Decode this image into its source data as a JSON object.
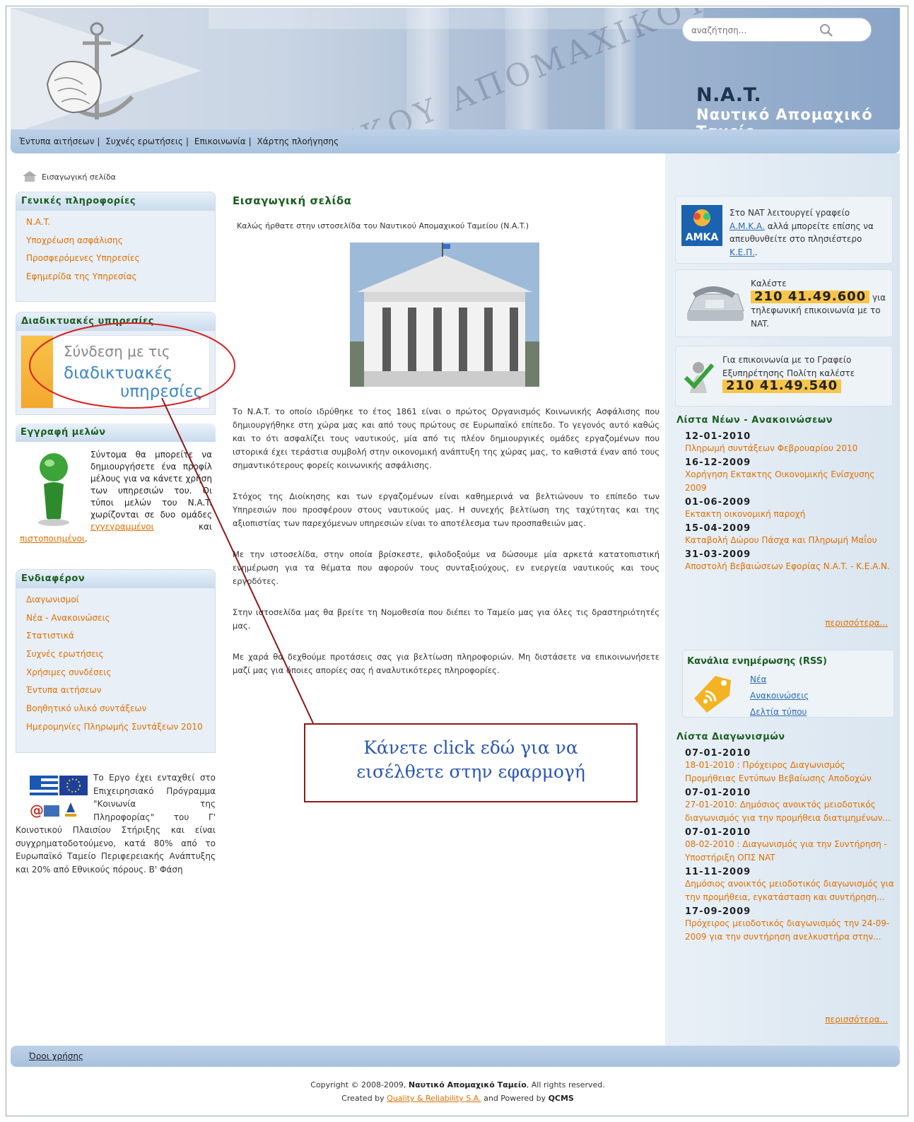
{
  "search": {
    "placeholder": "αναζήτηση..."
  },
  "header": {
    "abbr": "N.A.T.",
    "full": "Ναυτικό Απομαχικό Ταμείο",
    "facade_text": "ΝΑΥΤΙΚΟΥ ΑΠΟΜΑΧΙΚΟΥ ΤΑΜΕΙΟΥ"
  },
  "topnav": [
    "Έντυπα αιτήσεων",
    "Συχνές ερωτήσεις",
    "Επικοινωνία",
    "Χάρτης πλοήγησης"
  ],
  "breadcrumb": "Εισαγωγική σελίδα",
  "left": {
    "general": {
      "title": "Γενικές πληροφορίες",
      "items": [
        "N.A.T.",
        "Υποχρέωση ασφάλισης",
        "Προσφερόμενες Υπηρεσίες",
        "Εφημερίδα της Υπηρεσίας"
      ]
    },
    "online": {
      "title": "Διαδικτυακές υπηρεσίες",
      "banner": [
        "Σύνδεση με τις",
        "διαδικτυακές",
        "υπηρεσίες"
      ]
    },
    "members": {
      "title": "Εγγραφή μελών",
      "text": "Σύντομα θα μπορείτε να δημιουργήσετε ένα προφίλ μέλους για να κάνετε χρήση των υπηρεσιών του. Οι τύποι μελών του N.A.T. χωρίζονται σε δυο ομάδες",
      "link1": "εγγεγραμμένοι",
      "and": "και",
      "link2": "πιστοποιημένοι",
      "end": "."
    },
    "interest": {
      "title": "Ενδιαφέρον",
      "items": [
        "Διαγωνισμοί",
        "Νέα - Ανακοινώσεις",
        "Στατιστικά",
        "Συχνές ερωτήσεις",
        "Χρήσιμες συνδέσεις",
        "Έντυπα αιτήσεων",
        "Βοηθητικό υλικό συντάξεων",
        "Ημερομηνίες Πληρωμής Συντάξεων 2010"
      ]
    },
    "eu": "Το Εργο έχει ενταχθεί στο Επιχειρησιακό Πρόγραμμα \"Κοινωνία της Πληροφορίας\" του Γ' Κοινοτικού Πλαισίου Στήριξης και είναι συγχρηματοδοτούμενο, κατά 80% από το Ευρωπαϊκό Ταμείο Περιφερειακής Ανάπτυξης και 20% από Εθνικούς πόρους. Β' Φάση"
  },
  "main": {
    "title": "Εισαγωγική σελίδα",
    "welcome": "Καλώς ήρθατε στην ιστοσελίδα του Ναυτικού Απομαχικού Ταμείου (N.A.T.)",
    "paragraphs": [
      "Το N.A.T. το οποίο ιδρύθηκε το έτος 1861 είναι ο πρώτος Οργανισμός Κοινωνικής Ασφάλισης που δημιουργήθηκε στη χώρα μας και από τους πρώτους σε Ευρωπαϊκό επίπεδο. Το γεγονός αυτό καθώς και το ότι ασφαλίζει τους ναυτικούς, μία από τις πλέον δημιουργικές ομάδες εργαζομένων που ιστορικά έχει τεράστια συμβολή στην οικονομική ανάπτυξη της χώρας μας, το καθιστά έναν από τους σημαντικότερους φορείς κοινωνικής ασφάλισης.",
      "Στόχος της Διοίκησης και των εργαζομένων είναι καθημερινά να βελτιώνουν το επίπεδο των Υπηρεσιών που προσφέρουν στους ναυτικούς μας. Η συνεχής βελτίωση της ταχύτητας και της αξιοπιστίας των παρεχόμενων υπηρεσιών είναι το αποτέλεσμα των προσπαθειών μας.",
      "Με την ιστοσελίδα, στην οποία βρίσκεστε, φιλοδοξούμε να δώσουμε μία αρκετά κατατοπιστική ενημέρωση για τα θέματα που αφορούν τους συνταξιούχους, εν ενεργεία ναυτικούς και τους εργοδότες.",
      "Στην ιστοσελίδα μας θα βρείτε τη Νομοθεσία που διέπει το Ταμείο μας για όλες τις δραστηριότητές μας.",
      "Με χαρά θα δεχθούμε προτάσεις σας για βελτίωση πληροφοριών. Μη διστάσετε να επικοινωνήσετε μαζί μας για όποιες απορίες σας ή αναλυτικότερες πληροφορίες."
    ]
  },
  "callout": [
    "Κάνετε click εδώ για να",
    "εισέλθετε στην εφαρμογή"
  ],
  "right": {
    "amka": {
      "pre": "Στο NAT λειτουργεί γραφείο",
      "link1": "Α.Μ.Κ.Α.",
      "mid": "αλλά μπορείτε επίσης να απευθυνθείτε στο πλησιέστερο",
      "link2": "Κ.Ε.Π.",
      "end": ".",
      "logo": "AMKA"
    },
    "call": {
      "pre": "Καλέστε",
      "phone": "210 41.49.600",
      "post": "για τηλεφωνική επικοινωνία με το NAT."
    },
    "citizen": {
      "pre": "Για επικοινωνία με το Γραφείο Εξυπηρέτησης Πολίτη καλέστε",
      "phone": "210 41.49.540"
    },
    "news_title": "Λίστα Νέων - Ανακοινώσεων",
    "news": [
      {
        "date": "12-01-2010",
        "text": "Πληρωμή συντάξεων Φεβρουαρίου 2010"
      },
      {
        "date": "16-12-2009",
        "text": "Χορήγηση Εκτακτης Οικονομικής Ενίσχυσης 2009"
      },
      {
        "date": "01-06-2009",
        "text": "Εκτακτη οικονομική παροχή"
      },
      {
        "date": "15-04-2009",
        "text": "Καταβολή Δώρου Πάσχα και Πληρωμή Μαΐου"
      },
      {
        "date": "31-03-2009",
        "text": "Αποστολή Βεβαιώσεων Εφορίας N.A.T. - K.E.A.N."
      }
    ],
    "more1": "περισσότερα...",
    "rss_title": "Κανάλια ενημέρωσης (RSS)",
    "rss": [
      "Νέα",
      "Ανακοινώσεις",
      "Δελτία τύπου"
    ],
    "tenders_title": "Λίστα Διαγωνισμών",
    "tenders": [
      {
        "date": "07-01-2010",
        "text": "18-01-2010 : Πρόχειρος Διαγωνισμός Προμήθειας Εντύπων Βεβαίωσης Αποδοχών"
      },
      {
        "date": "07-01-2010",
        "text": "27-01-2010: Δημόσιος ανοικτός μειοδοτικός διαγωνισμός για την προμήθεια διατιμημένων..."
      },
      {
        "date": "07-01-2010",
        "text": "08-02-2010 : Διαγωνισμός για την Συντήρηση - Υποστήριξη ΟΠΣ NAT"
      },
      {
        "date": "11-11-2009",
        "text": "Δημόσιος ανοικτός μειοδοτικός διαγωνισμός για την προμήθεια, εγκατάσταση και συντήρηση..."
      },
      {
        "date": "17-09-2009",
        "text": "Πρόχειρος μειοδοτικός διαγωνισμός την 24-09-2009 για την συντήρηση ανελκυστήρα στην..."
      }
    ],
    "more2": "περισσότερα..."
  },
  "footer": {
    "terms": "Όροι χρήσης",
    "copy_pre": "Copyright © 2008-2009,",
    "copy_org": "Ναυτικό Απομαχικό Ταμείο",
    "copy_post": ", All rights reserved.",
    "created_pre": "Created by",
    "created_link": "Quality & Reliability S.A.",
    "created_mid": "and Powered by",
    "created_brand": "QCMS"
  },
  "colors": {
    "accent_green": "#1b5e20",
    "link_orange": "#e07000",
    "phone_yellow": "#f7c54a",
    "annotation_red": "#8b1a1a"
  }
}
